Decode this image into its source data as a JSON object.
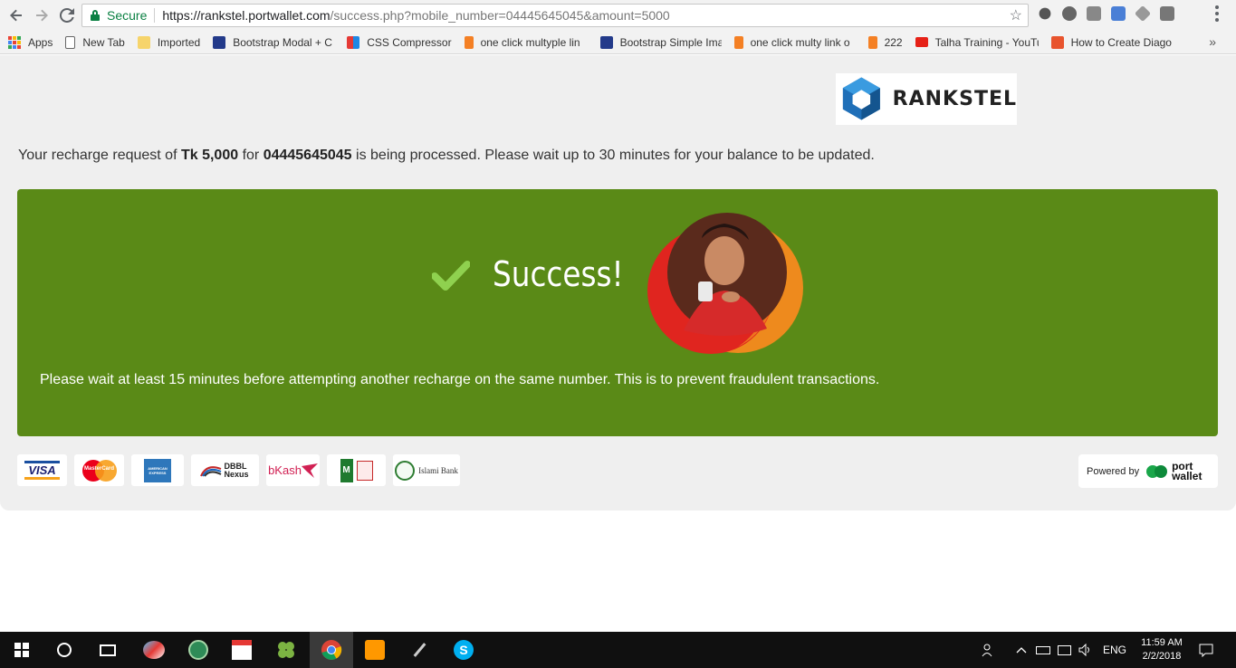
{
  "browser": {
    "secure_label": "Secure",
    "url_host": "https://rankstel.portwallet.com",
    "url_rest": "/success.php?mobile_number=04445645045&amount=5000",
    "bookmarks": [
      {
        "label": "Apps"
      },
      {
        "label": "New Tab"
      },
      {
        "label": "Imported"
      },
      {
        "label": "Bootstrap Modal + C"
      },
      {
        "label": "CSS Compressor"
      },
      {
        "label": "one click multyple lin"
      },
      {
        "label": "Bootstrap Simple Ima"
      },
      {
        "label": "one click multy link o"
      },
      {
        "label": "222"
      },
      {
        "label": "Talha Training - YouTu"
      },
      {
        "label": "How to Create Diago"
      }
    ],
    "more_bookmarks": "»"
  },
  "page": {
    "logo_text": "RANKSTEL",
    "notice": {
      "prefix": "Your recharge request of ",
      "amount": "Tk 5,000",
      "middle": " for ",
      "number": "04445645045",
      "suffix": " is being processed. Please wait up to 30 minutes for your balance to be updated."
    },
    "success_title": "Success!",
    "wait_note": "Please wait at least 15 minutes before attempting another recharge on the same number. This is to prevent fraudulent transactions.",
    "payment_methods": [
      {
        "label": "VISA",
        "color": "#1a1f71"
      },
      {
        "label": "MasterCard",
        "color": "#eb001b"
      },
      {
        "label": "AMERICAN EXPRESS",
        "color": "#2e77bb"
      },
      {
        "label": "DBBL Nexus",
        "color": "#222222"
      },
      {
        "label": "bKash",
        "color": "#d12053"
      },
      {
        "label": "M",
        "color": "#1f7a2e"
      },
      {
        "label": "Islami Bank",
        "color": "#333333"
      }
    ],
    "powered_by": "Powered by",
    "powered_brand_1": "port",
    "powered_brand_2": "wallet",
    "colors": {
      "success_green": "#5a8a17",
      "page_bg": "#efefef"
    }
  },
  "taskbar": {
    "time": "11:59 AM",
    "date": "2/2/2018",
    "lang": "ENG"
  }
}
